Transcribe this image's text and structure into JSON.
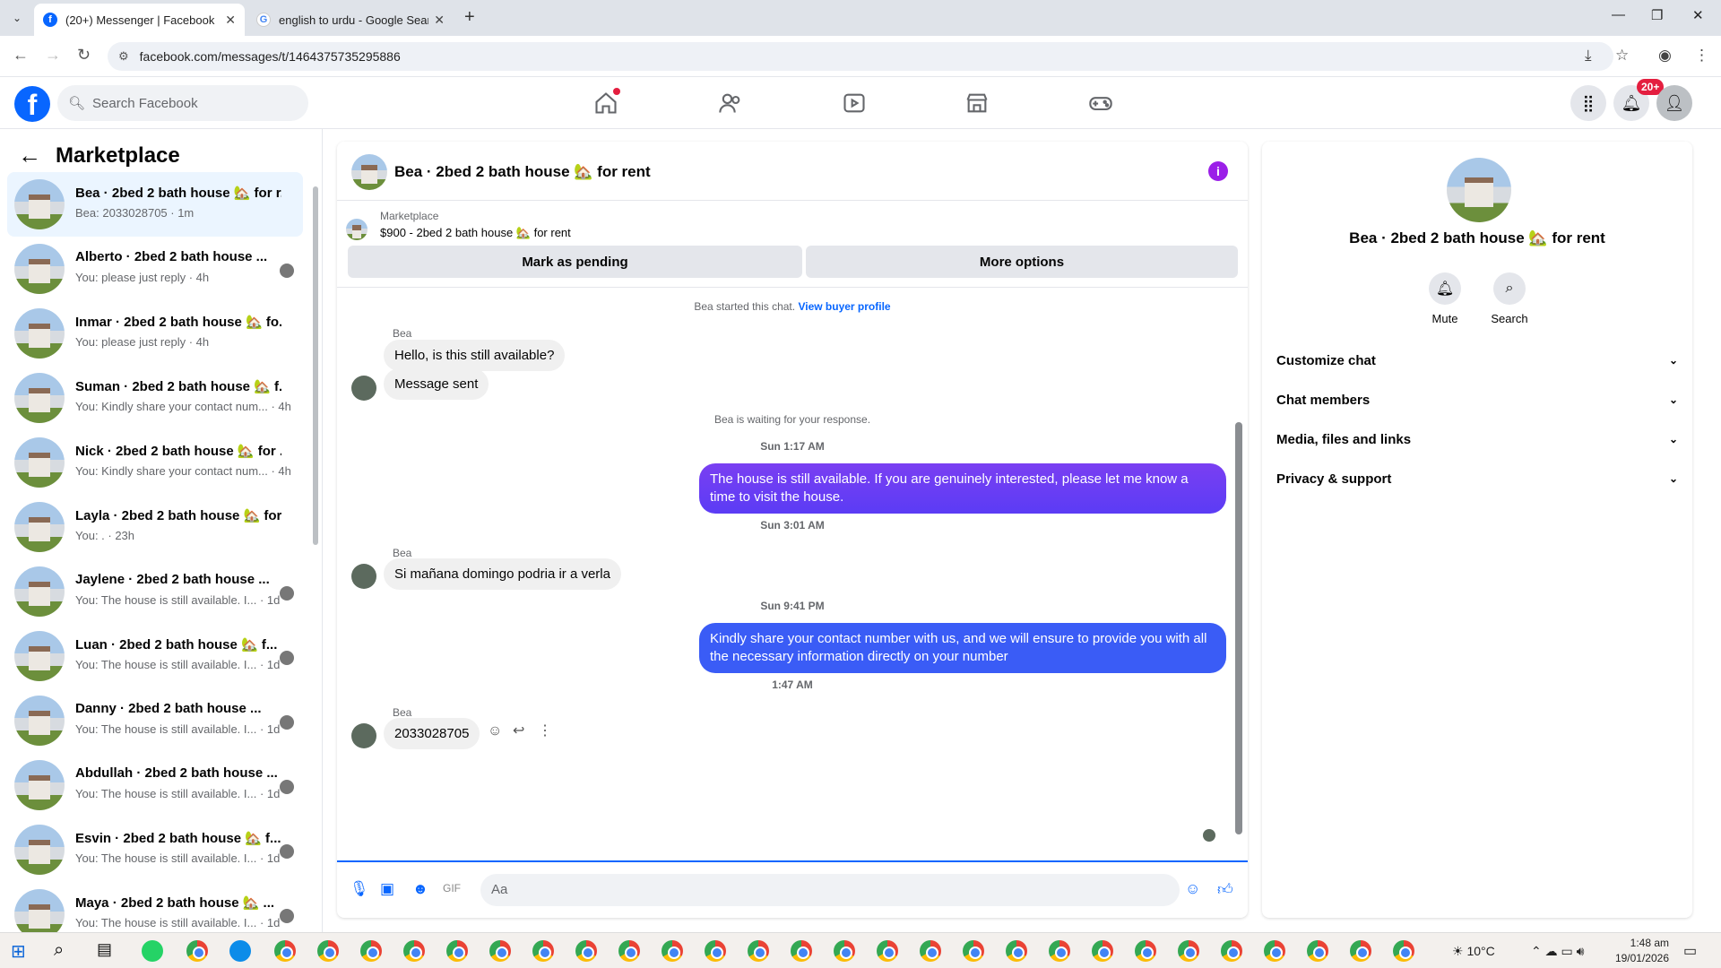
{
  "browser": {
    "tabs": [
      {
        "title": "(20+) Messenger | Facebook",
        "active": true
      },
      {
        "title": "english to urdu - Google Search",
        "active": false
      }
    ],
    "url": "facebook.com/messages/t/1464375735295886"
  },
  "fb_header": {
    "search_placeholder": "Search Facebook",
    "notif_badge": "20+"
  },
  "sidebar": {
    "title": "Marketplace",
    "conversations": [
      {
        "name": "Bea · 2bed 2 bath house 🏡 for r...",
        "snippet": "Bea: 2033028705 · 1m",
        "active": true
      },
      {
        "name": "Alberto · 2bed 2 bath house ...",
        "snippet": "You: please just reply · 4h"
      },
      {
        "name": "Inmar · 2bed 2 bath house 🏡 fo...",
        "snippet": "You: please just reply · 4h"
      },
      {
        "name": "Suman · 2bed 2 bath house 🏡 f...",
        "snippet": "You: Kindly share your contact num... · 4h"
      },
      {
        "name": "Nick · 2bed 2 bath house 🏡 for ...",
        "snippet": "You: Kindly share your contact num... · 4h"
      },
      {
        "name": "Layla · 2bed 2 bath house 🏡 for...",
        "snippet": "You: . · 23h"
      },
      {
        "name": "Jaylene · 2bed 2 bath house ...",
        "snippet": "You: The house is still available. I... · 1d"
      },
      {
        "name": "Luan · 2bed 2 bath house 🏡 f...",
        "snippet": "You: The house is still available. I... · 1d"
      },
      {
        "name": "Danny · 2bed 2 bath house ...",
        "snippet": "You: The house is still available. I... · 1d"
      },
      {
        "name": "Abdullah · 2bed 2 bath house ...",
        "snippet": "You: The house is still available. I... · 1d"
      },
      {
        "name": "Esvin · 2bed 2 bath house 🏡 f...",
        "snippet": "You: The house is still available. I... · 1d"
      },
      {
        "name": "Maya · 2bed 2 bath house 🏡 ...",
        "snippet": "You: The house is still available. I... · 1d"
      }
    ]
  },
  "chat": {
    "title": "Bea · 2bed 2 bath house 🏡 for rent",
    "listing_category": "Marketplace",
    "listing_title": "$900 - 2bed 2 bath house 🏡 for rent",
    "mark_pending": "Mark as pending",
    "more_options": "More options",
    "started": "Bea started this chat.",
    "view_profile": "View buyer profile",
    "sender": "Bea",
    "msg1": "Hello, is this still available?",
    "msg2": "Message sent",
    "waiting": "Bea is waiting for your response.",
    "ts1": "Sun 1:17 AM",
    "out1": "The house is still available. If you are genuinely interested, please let me know a time to visit the house.",
    "ts2": "Sun 3:01 AM",
    "msg3": "Si mañana domingo podria ir a verla",
    "ts3": "Sun 9:41 PM",
    "out2": "Kindly share your contact number with us, and we will ensure to provide you with all the necessary information directly on your number",
    "ts4": "1:47 AM",
    "msg4": "2033028705",
    "composer_placeholder": "Aa"
  },
  "right_panel": {
    "name": "Bea · 2bed 2 bath house 🏡 for rent",
    "mute": "Mute",
    "search": "Search",
    "rows": [
      "Customize chat",
      "Chat members",
      "Media, files and links",
      "Privacy & support"
    ]
  },
  "taskbar": {
    "temperature": "10°C",
    "time": "1:48 am",
    "date": "19/01/2026"
  },
  "colors": {
    "fb_blue": "#0866ff",
    "outgoing_purple": "#6a3df3",
    "outgoing_blue": "#3a5cf6",
    "badge_red": "#e41e3f"
  }
}
